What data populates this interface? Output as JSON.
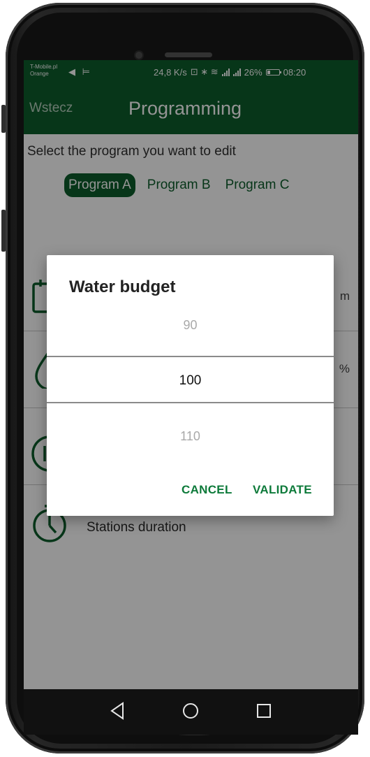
{
  "status_bar": {
    "carrier_line1": "T-Mobile.pl",
    "carrier_line2": "Orange",
    "left_icons": "◀ ⊨",
    "speed": "24,8 K/s",
    "nfc_bt_wifi": "⊡ ∗ ≋",
    "battery_pct": "26%",
    "battery_level": 0.26,
    "time": "08:20"
  },
  "header": {
    "back_label": "Wstecz",
    "title": "Programming"
  },
  "content": {
    "subtitle": "Select the program you want to edit",
    "program_tabs": [
      {
        "label": "Program A",
        "active": true
      },
      {
        "label": "Program B",
        "active": false
      },
      {
        "label": "Program C",
        "active": false
      }
    ],
    "rows": [
      {
        "icon": "calendar-icon",
        "label": "",
        "value": "m"
      },
      {
        "icon": "water-drop-icon",
        "label": "",
        "value": "%"
      },
      {
        "icon": "start-time-icon",
        "label": "",
        "value": ""
      },
      {
        "icon": "stopwatch-icon",
        "label": "Stations duration",
        "value": ""
      }
    ]
  },
  "dialog": {
    "title": "Water budget",
    "picker": {
      "prev": "90",
      "selected": "100",
      "next": "110"
    },
    "cancel_label": "CANCEL",
    "validate_label": "VALIDATE"
  },
  "navbar": {
    "back_icon": "triangle-back-icon",
    "home_icon": "circle-home-icon",
    "recents_icon": "square-recents-icon"
  },
  "colors": {
    "brand_green": "#0d5e2c",
    "button_green": "#0d7a3a",
    "overlay": "rgba(0,0,0,0.42)"
  }
}
